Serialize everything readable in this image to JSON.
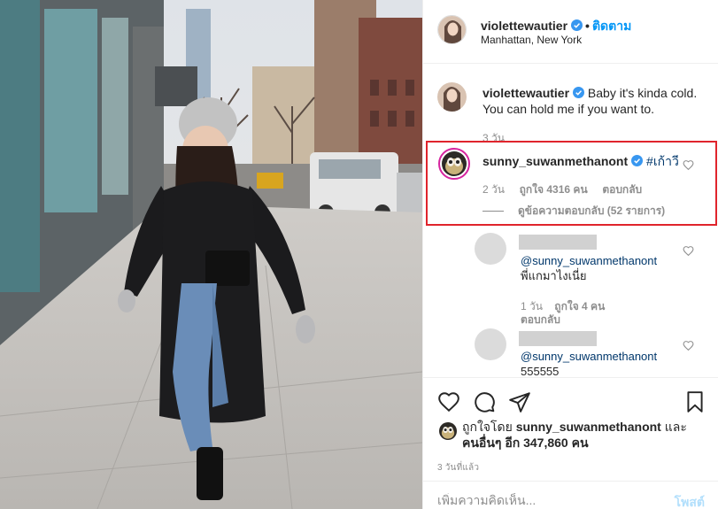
{
  "header": {
    "username": "violettewautier",
    "separator": "•",
    "follow_label": "ติดตาม",
    "location": "Manhattan, New York"
  },
  "caption": {
    "username": "violettewautier",
    "text": "Baby it's kinda cold. You can hold me if you want to.",
    "time": "3 วัน"
  },
  "comment": {
    "username": "sunny_suwanmethanont",
    "text": "#เก้าวี",
    "time": "2 วัน",
    "likes": "ถูกใจ 4316 คน",
    "reply_label": "ตอบกลับ",
    "view_replies": "ดูข้อความตอบกลับ (52 รายการ)"
  },
  "replies": [
    {
      "mention": "@sunny_suwanmethanont",
      "text": "พี่แกมาไงเนี่ย",
      "time": "1 วัน",
      "likes": "ถูกใจ 4 คน",
      "reply_label": "ตอบกลับ"
    },
    {
      "mention": "@sunny_suwanmethanont",
      "text": "555555"
    }
  ],
  "liked_by": {
    "prefix": "ถูกใจโดย",
    "user": "sunny_suwanmethanont",
    "and": "และ",
    "others": "คนอื่นๆ อีก 347,860 คน"
  },
  "time_ago": "3 วันที่แล้ว",
  "add_comment": {
    "placeholder": "เพิ่มความคิดเห็น...",
    "post_label": "โพสต์"
  },
  "colors": {
    "accent": "#0095f6",
    "highlight_border": "#e0242c",
    "muted": "#8e8e8e"
  },
  "icons": [
    "verified-icon",
    "heart-icon",
    "comment-icon",
    "share-icon",
    "bookmark-icon"
  ]
}
